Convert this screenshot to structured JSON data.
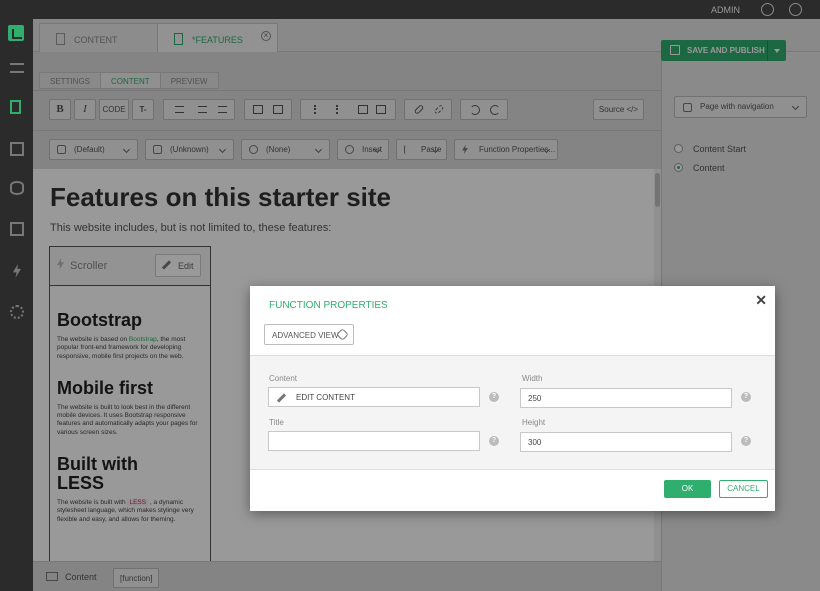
{
  "topbar": {
    "user": "ADMIN"
  },
  "doc_tabs": [
    {
      "label": "CONTENT"
    },
    {
      "label": "*FEATURES"
    }
  ],
  "editor_tabs": [
    "SETTINGS",
    "CONTENT",
    "PREVIEW"
  ],
  "toolbar": {
    "bold": "B",
    "italic": "I",
    "code": "CODE",
    "text": "T-",
    "source": "Source </>"
  },
  "format_bar": {
    "style": "(Default)",
    "block": "(Unknown)",
    "class": "(None)",
    "insert": "Insert",
    "paste": "Paste",
    "function_properties": "Function Properties..."
  },
  "document": {
    "heading": "Features on this starter site",
    "lead": "This website includes, but is not limited to, these features:",
    "scroller": {
      "label": "Scroller",
      "edit": "Edit",
      "items": [
        {
          "title": "Bootstrap",
          "text_before": "The website is based on ",
          "link": "Bootstrap",
          "text_after": ", the most popular front-end framework for developing responsive, mobile first projects on the web."
        },
        {
          "title": "Mobile first",
          "text": "The website is built to look best in the different mobile devices. It uses Bootstrap responsive features and  automatically adapts your pages for various screen sizes."
        },
        {
          "title": "Built with LESS",
          "text_before": "The website is built with ",
          "code": "LESS",
          "text_after": " , a dynamic stylesheet language, which makes stylinge very flexible and easy, and allows for theming."
        }
      ]
    }
  },
  "statusbar": {
    "label": "Content",
    "path": "[function]"
  },
  "right_panel": {
    "save_button": "SAVE AND PUBLISH",
    "page_type": "Page with navigation",
    "placeholders": [
      {
        "label": "Content Start",
        "selected": false
      },
      {
        "label": "Content",
        "selected": true
      }
    ]
  },
  "modal": {
    "title": "FUNCTION PROPERTIES",
    "advanced_view": "ADVANCED VIEW",
    "fields": {
      "content_label": "Content",
      "content_button": "EDIT CONTENT",
      "title_label": "Title",
      "title_value": "",
      "width_label": "Width",
      "width_value": "250",
      "height_label": "Height",
      "height_value": "300"
    },
    "ok": "OK",
    "cancel": "CANCEL",
    "help_glyph": "?",
    "close_glyph": "✕"
  },
  "colors": {
    "accent": "#2fae6e",
    "dark": "#2b2b2b"
  }
}
